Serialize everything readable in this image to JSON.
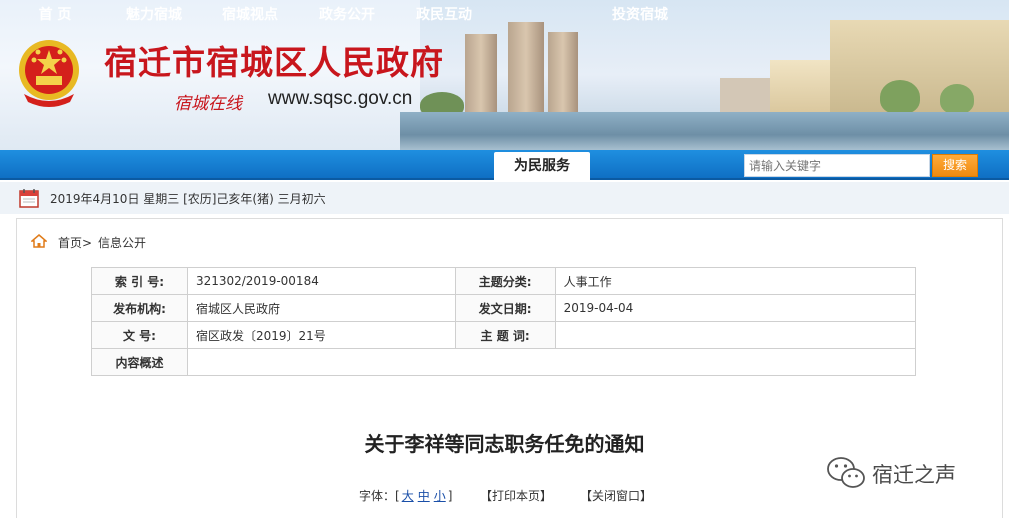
{
  "header": {
    "site_title": "宿迁市宿城区人民政府",
    "slogan": "宿城在线",
    "url": "www.sqsc.gov.cn",
    "title_color": "#c8161d"
  },
  "nav": {
    "items": [
      {
        "label": "首  页"
      },
      {
        "label": "魅力宿城"
      },
      {
        "label": "宿城视点"
      },
      {
        "label": "政务公开"
      },
      {
        "label": "政民互动"
      },
      {
        "label": "为民服务",
        "active": true
      },
      {
        "label": "投资宿城"
      }
    ],
    "search": {
      "placeholder": "请输入关键字",
      "button_label": "搜索"
    },
    "bar_color": "#1a82d8"
  },
  "datebar": {
    "icon": "calendar-icon",
    "text": "2019年4月10日  星期三  [农历]己亥年(猪)  三月初六"
  },
  "breadcrumb": {
    "icon": "home-icon",
    "home": "首页>",
    "current": "信息公开"
  },
  "meta_table": {
    "rows": [
      {
        "label1": "索 引 号:",
        "value1": "321302/2019-00184",
        "label2": "主题分类:",
        "value2": "人事工作"
      },
      {
        "label1": "发布机构:",
        "value1": "宿城区人民政府",
        "label2": "发文日期:",
        "value2": "2019-04-04"
      },
      {
        "label1": "文    号:",
        "value1": "宿区政发〔2019〕21号",
        "label2": "主 题 词:",
        "value2": ""
      },
      {
        "label1": "内容概述",
        "value1": ""
      }
    ]
  },
  "document": {
    "title": "关于李祥等同志职务任免的通知",
    "font_label": "字体：[",
    "font_large": "大",
    "font_medium": "中",
    "font_small": "小",
    "font_close": "]",
    "print_label": "【打印本页】",
    "close_label": "【关闭窗口】"
  },
  "watermark": {
    "icon": "wechat-icon",
    "text": "宿迁之声"
  }
}
